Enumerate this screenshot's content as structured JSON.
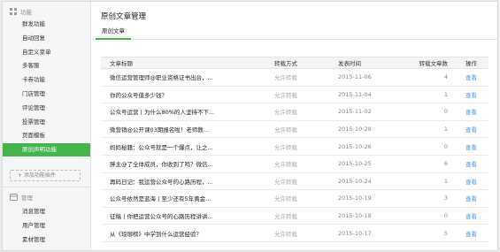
{
  "sidebar": {
    "section1": {
      "label": "功能"
    },
    "items": [
      {
        "label": "群发功能",
        "active": false
      },
      {
        "label": "自动回复",
        "active": false
      },
      {
        "label": "自定义菜单",
        "active": false
      },
      {
        "label": "多客服",
        "active": false
      },
      {
        "label": "卡券功能",
        "active": false
      },
      {
        "label": "门店管理",
        "active": false
      },
      {
        "label": "评论管理",
        "active": false
      },
      {
        "label": "投票管理",
        "active": false
      },
      {
        "label": "页面模板",
        "active": false
      },
      {
        "label": "原创声明功能",
        "active": true
      }
    ],
    "add_plugin_label": "+ 添加功能插件",
    "section2": {
      "label": "管理"
    },
    "items2": [
      {
        "label": "消息管理"
      },
      {
        "label": "用户管理"
      },
      {
        "label": "素材管理"
      }
    ]
  },
  "main": {
    "title": "原创文章管理",
    "tab_label": "原创文章",
    "table": {
      "headers": {
        "title": "文章标题",
        "mode": "转载方式",
        "date": "发表时间",
        "count": "转载文章数",
        "op": "操作"
      },
      "rows": [
        {
          "title": "微信运营管理师@职业资格证书出台，...",
          "mode": "允许转载",
          "date": "2015-11-06",
          "count": "4",
          "op": "查看"
        },
        {
          "title": "你的公众号值多少钱？",
          "mode": "允许转载",
          "date": "2015-11-04",
          "count": "1",
          "op": "查看"
        },
        {
          "title": "公众号运营丨为什么80%的人坚持不下...",
          "mode": "允许转载",
          "date": "2015-11-02",
          "count": "0",
          "op": "查看"
        },
        {
          "title": "微营销@公开课03期报名啦！老师教...",
          "mode": "允许转载",
          "date": "2015-10-28",
          "count": "1",
          "op": "查看"
        },
        {
          "title": "妈妈秘籍：公众号就是一个爆点，让之...",
          "mode": "允许转载",
          "date": "2015-10-26",
          "count": "0",
          "op": "查看"
        },
        {
          "title": "胖主@了全体成员，你收到了吗？微信...",
          "mode": "允许转载",
          "date": "2015-10-25",
          "count": "6",
          "op": "查看"
        },
        {
          "title": "再码日记：我运营公众号的心路历程，...",
          "mode": "允许转载",
          "date": "2015-10-24",
          "count": "1",
          "op": "查看"
        },
        {
          "title": "公众号依然是蓝海丨至少还有5年黄金...",
          "mode": "允许转载",
          "date": "2015-10-19",
          "count": "3",
          "op": "查看"
        },
        {
          "title": "征稿丨你把运营公众号的心路历程讲讲...",
          "mode": "允许转载",
          "date": "2015-10-18",
          "count": "0",
          "op": "查看"
        },
        {
          "title": "从《琅琊榜》中学到什么运营经验？",
          "mode": "允许转载",
          "date": "2015-10-17",
          "count": "5",
          "op": "查看"
        }
      ]
    }
  },
  "colors": {
    "accent": "#44b549",
    "link": "#459ae9"
  }
}
